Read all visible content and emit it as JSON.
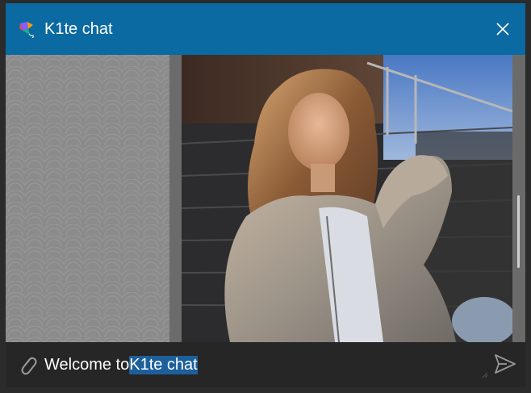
{
  "window": {
    "title": "K1te chat",
    "accent_color": "#0a6aa1"
  },
  "icons": {
    "app": "kite-icon",
    "close": "close-icon",
    "attach": "paperclip-icon",
    "send": "send-icon"
  },
  "input": {
    "text_prefix": "Welcome to ",
    "text_selected": "K1te chat"
  }
}
